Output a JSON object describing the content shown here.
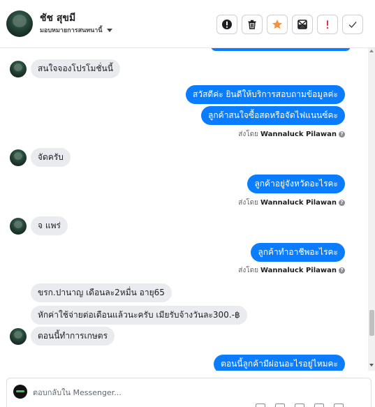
{
  "header": {
    "contact_name": "ชัช สุขมี",
    "assign_label": "มอบหมายการสนทนานี้",
    "toolbar": [
      {
        "name": "spam-button",
        "icon": "alert-circle-icon"
      },
      {
        "name": "delete-button",
        "icon": "trash-icon"
      },
      {
        "name": "star-button",
        "icon": "star-icon"
      },
      {
        "name": "archive-button",
        "icon": "archive-box-icon"
      },
      {
        "name": "follow-up-button",
        "icon": "exclamation-icon"
      },
      {
        "name": "done-button",
        "icon": "check-icon"
      }
    ]
  },
  "colors": {
    "outgoing_bubble": "#0a7cff",
    "incoming_bubble": "#e9ebee",
    "star": "#f7923a",
    "exclamation": "#e4304f"
  },
  "messages": [
    {
      "dir": "in",
      "text": "สนใจจองโปรโมชั่นนี้"
    },
    {
      "dir": "out",
      "text": "สวัสดีค่ะ  ยินดีให้บริการสอบถามข้อมูลค่ะ"
    },
    {
      "dir": "out",
      "text": "ลูกค้าสนใจซื้อสดหรือจัดไฟแนนซ์คะ"
    },
    {
      "dir": "sent_by",
      "label": "ส่งโดย",
      "agent": "Wannaluck Pilawan"
    },
    {
      "dir": "in",
      "text": "จัดครับ"
    },
    {
      "dir": "out",
      "text": "ลูกค้าอยู่จังหวัดอะไรคะ"
    },
    {
      "dir": "sent_by",
      "label": "ส่งโดย",
      "agent": "Wannaluck Pilawan"
    },
    {
      "dir": "in",
      "text": "จ แพร่"
    },
    {
      "dir": "out",
      "text": "ลูกค้าทำอาชีพอะไรคะ"
    },
    {
      "dir": "sent_by",
      "label": "ส่งโดย",
      "agent": "Wannaluck Pilawan"
    },
    {
      "dir": "in",
      "text": "ขรก.ปานาญ เดือนละ2หมื่น อายุ65"
    },
    {
      "dir": "in",
      "text": "หักค่าใช้จ่ายต่อเดือนแล้วนะครับ เมียรับจ้างวันละ300.-฿"
    },
    {
      "dir": "in",
      "text": "ตอนนี้ทำการเกษตร"
    },
    {
      "dir": "out",
      "text": "ตอนนี้ลูกค้ามีผ่อนอะไรอยู่ไหมคะ"
    }
  ],
  "composer": {
    "placeholder": "ตอบกลับใน Messenger..."
  }
}
